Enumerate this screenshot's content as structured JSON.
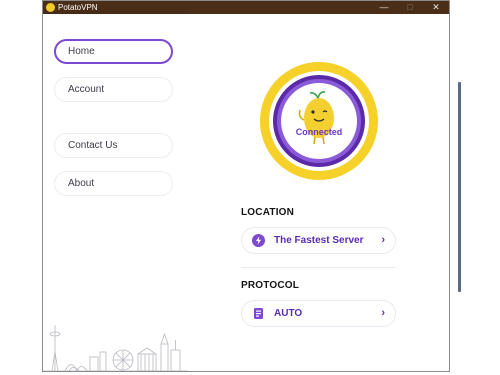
{
  "window": {
    "title": "PotatoVPN",
    "minimize": "—",
    "maximize": "□",
    "close": "✕"
  },
  "sidebar": {
    "items": [
      {
        "label": "Home"
      },
      {
        "label": "Account"
      },
      {
        "label": "Contact Us"
      },
      {
        "label": "About"
      }
    ],
    "active": "Home"
  },
  "status": {
    "label": "Connected"
  },
  "location": {
    "title": "LOCATION",
    "value": "The Fastest Server",
    "icon": "bolt-icon"
  },
  "protocol": {
    "title": "PROTOCOL",
    "value": "AUTO",
    "icon": "protocol-icon"
  },
  "colors": {
    "accent": "#7c49d0",
    "ring_outer": "#f6d12a",
    "ring_inner": "#6c35c9",
    "titlebar": "#4a2e18"
  }
}
